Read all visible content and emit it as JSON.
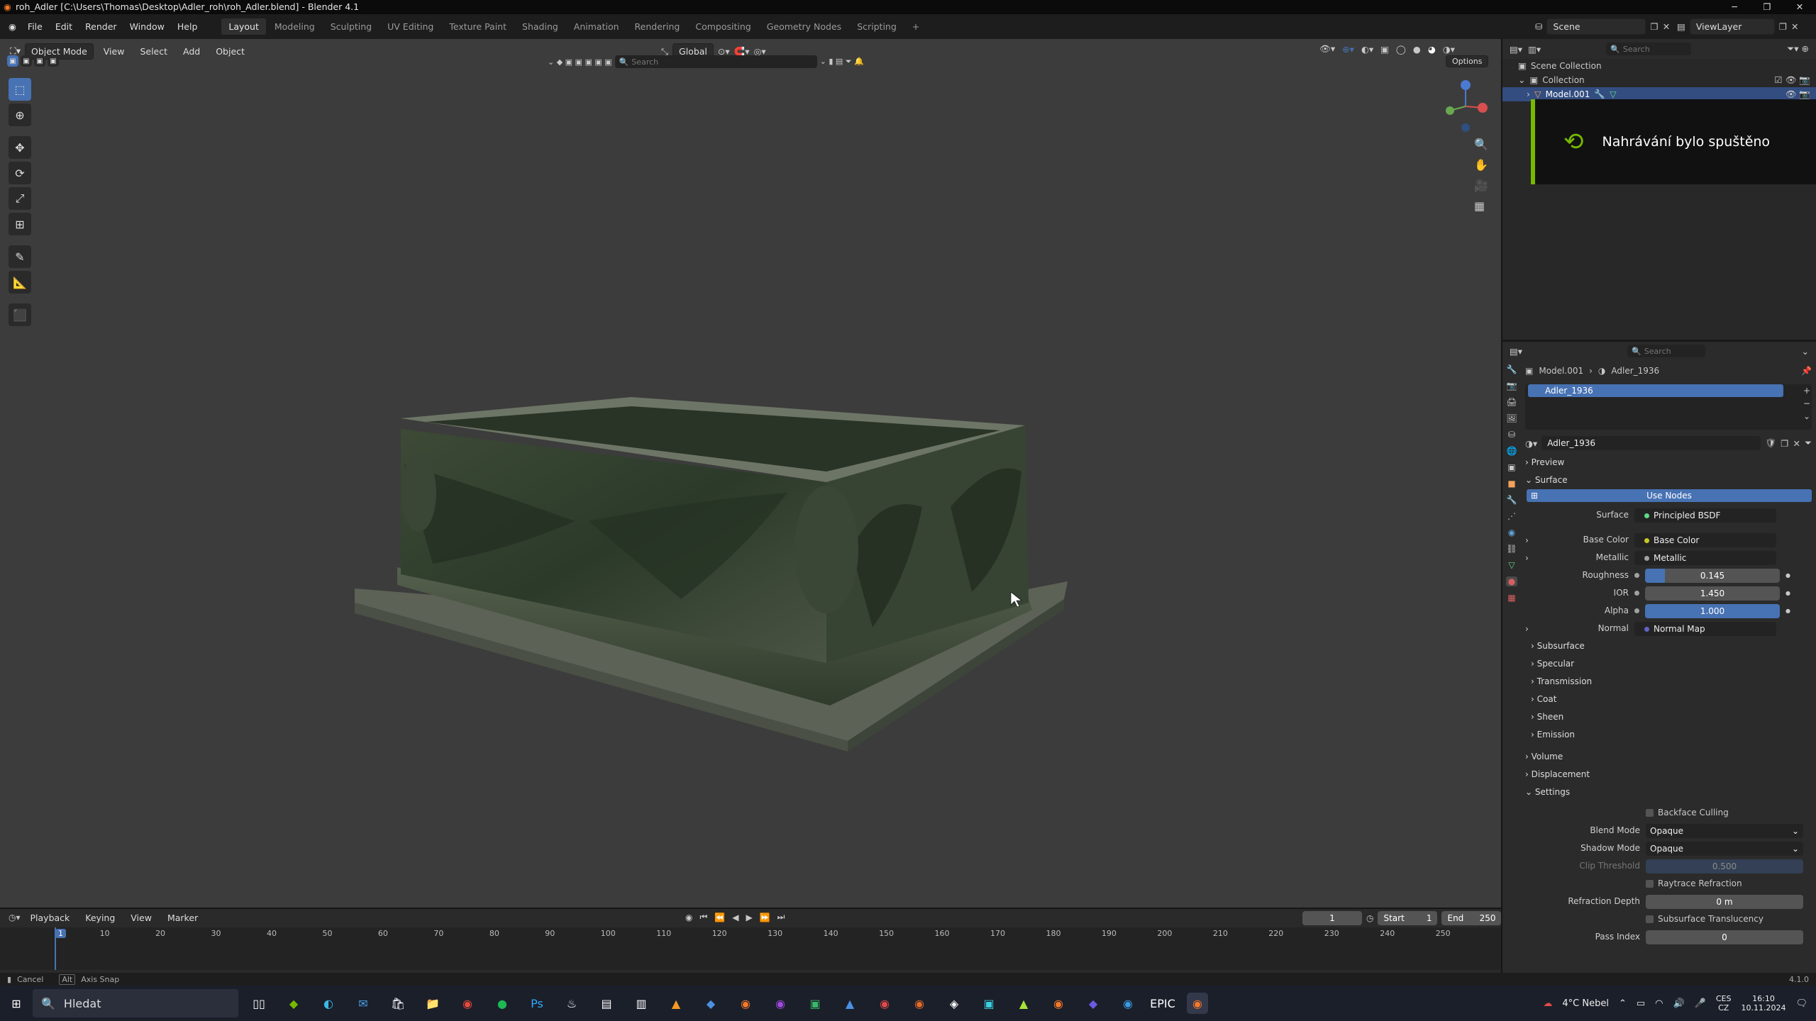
{
  "window": {
    "title": "roh_Adler [C:\\Users\\Thomas\\Desktop\\Adler_roh\\roh_Adler.blend] - Blender 4.1"
  },
  "menu": [
    "File",
    "Edit",
    "Render",
    "Window",
    "Help"
  ],
  "workspaces": [
    "Layout",
    "Modeling",
    "Sculpting",
    "UV Editing",
    "Texture Paint",
    "Shading",
    "Animation",
    "Rendering",
    "Compositing",
    "Geometry Nodes",
    "Scripting"
  ],
  "scene": {
    "name": "Scene",
    "view_layer": "ViewLayer",
    "search_placeholder": "Search"
  },
  "viewport": {
    "mode": "Object Mode",
    "menu": [
      "View",
      "Select",
      "Add",
      "Object"
    ],
    "orientation": "Global",
    "search_placeholder": "Search",
    "options_label": "Options"
  },
  "outliner": {
    "scene_collection": "Scene Collection",
    "collection": "Collection",
    "object": "Model.001"
  },
  "toast": {
    "text": "Nahrávání bylo spuštěno"
  },
  "properties": {
    "search_placeholder": "Search",
    "breadcrumb": [
      "Model.001",
      "Adler_1936"
    ],
    "material_slot": "Adler_1936",
    "material_name": "Adler_1936",
    "sections": {
      "preview": "Preview",
      "surface": "Surface",
      "volume": "Volume",
      "displacement": "Displacement",
      "settings": "Settings"
    },
    "use_nodes": "Use Nodes",
    "surface_label": "Surface",
    "surface_value": "Principled BSDF",
    "base_color": {
      "label": "Base Color",
      "value": "Base Color"
    },
    "metallic": {
      "label": "Metallic",
      "value": "Metallic"
    },
    "roughness": {
      "label": "Roughness",
      "value": "0.145",
      "fraction": 0.145
    },
    "ior": {
      "label": "IOR",
      "value": "1.450"
    },
    "alpha": {
      "label": "Alpha",
      "value": "1.000",
      "fraction": 1.0
    },
    "normal": {
      "label": "Normal",
      "value": "Normal Map"
    },
    "subsections": [
      "Subsurface",
      "Specular",
      "Transmission",
      "Coat",
      "Sheen",
      "Emission"
    ],
    "backface_culling": "Backface Culling",
    "blend_mode": {
      "label": "Blend Mode",
      "value": "Opaque"
    },
    "shadow_mode": {
      "label": "Shadow Mode",
      "value": "Opaque"
    },
    "clip_threshold": {
      "label": "Clip Threshold",
      "value": "0.500"
    },
    "raytrace_refraction": "Raytrace Refraction",
    "refraction_depth": {
      "label": "Refraction Depth",
      "value": "0 m"
    },
    "subsurface_translucency": "Subsurface Translucency",
    "pass_index": {
      "label": "Pass Index",
      "value": "0"
    }
  },
  "timeline": {
    "menu": [
      "Playback",
      "Keying",
      "View",
      "Marker"
    ],
    "current_frame": "1",
    "start_label": "Start",
    "start": "1",
    "end_label": "End",
    "end": "250",
    "ticks": [
      "1",
      "10",
      "20",
      "30",
      "40",
      "50",
      "60",
      "70",
      "80",
      "90",
      "100",
      "110",
      "120",
      "130",
      "140",
      "150",
      "160",
      "170",
      "180",
      "190",
      "200",
      "210",
      "220",
      "230",
      "240",
      "250"
    ]
  },
  "status": {
    "cancel": "Cancel",
    "alt": "Alt",
    "axis_snap": "Axis Snap",
    "version": "4.1.0"
  },
  "taskbar": {
    "search": "Hledat",
    "weather": "4°C  Nebel",
    "lang": "CES",
    "lang2": "CZ",
    "time": "16:10",
    "date": "10.11.2024"
  },
  "colors": {
    "accent": "#4772b3",
    "header_bg": "#1d1d1d",
    "viewport_bg": "#3c3c3c",
    "toast_accent": "#76b900"
  }
}
